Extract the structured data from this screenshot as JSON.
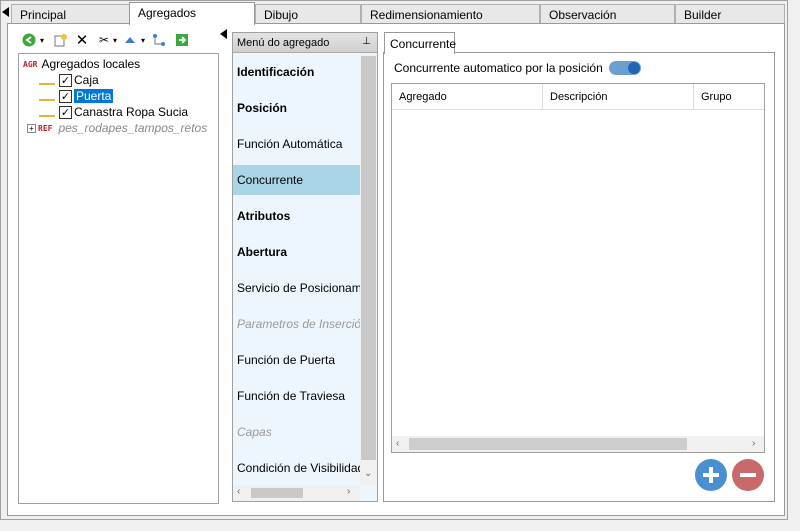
{
  "tabs": [
    {
      "label": "Principal"
    },
    {
      "label": "Agregados"
    },
    {
      "label": "Dibujo"
    },
    {
      "label": "Redimensionamiento"
    },
    {
      "label": "Observación"
    },
    {
      "label": "Builder"
    }
  ],
  "active_tab": "Agregados",
  "toolbar": {
    "icons": [
      "back-icon",
      "new-icon",
      "delete-icon",
      "cut-icon",
      "move-up-icon",
      "tree-icon",
      "export-icon"
    ]
  },
  "tree": {
    "root_prefix": "AGR",
    "root_label": "Agregados locales",
    "items": [
      {
        "label": "Caja",
        "checked": true
      },
      {
        "label": "Puerta",
        "checked": true,
        "selected": true
      },
      {
        "label": "Canastra Ropa Sucia",
        "checked": true
      }
    ],
    "ref_prefix": "REF",
    "ref_label": "pes_rodapes_tampos_retos"
  },
  "menu": {
    "header": "Menú do agregado",
    "items": [
      {
        "label": "Identificación",
        "style": "bold"
      },
      {
        "label": "Posición",
        "style": "bold"
      },
      {
        "label": "Función Automática",
        "style": "normal"
      },
      {
        "label": "Concurrente",
        "style": "active"
      },
      {
        "label": "Atributos",
        "style": "bold"
      },
      {
        "label": "Abertura",
        "style": "bold"
      },
      {
        "label": "Servicio de Posicionamie",
        "style": "normal"
      },
      {
        "label": "Parametros de Inserción",
        "style": "disabled"
      },
      {
        "label": "Función de Puerta",
        "style": "normal"
      },
      {
        "label": "Función de Traviesa",
        "style": "normal"
      },
      {
        "label": "Capas",
        "style": "disabled"
      },
      {
        "label": "Condición de Visibilidad",
        "style": "normal"
      }
    ]
  },
  "right": {
    "tab_label": "Concurrente",
    "toggle_label": "Concurrente automatico por la posición",
    "toggle_on": true,
    "columns": [
      "Agregado",
      "Descripción",
      "Grupo"
    ],
    "colors": {
      "add": "#4a8fd1",
      "remove": "#c86a6a"
    }
  }
}
